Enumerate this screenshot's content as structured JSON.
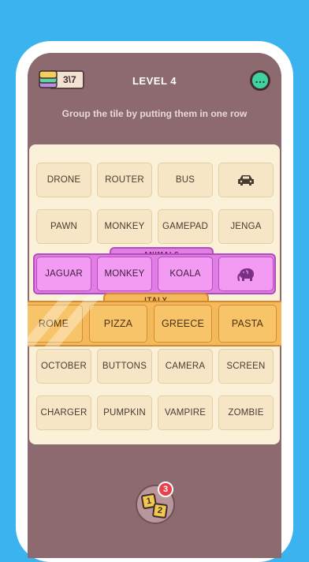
{
  "header": {
    "counter": "3\\7",
    "level_title": "LEVEL 4",
    "menu_icon": "ellipsis-icon"
  },
  "instruction": "Group the tile by putting them in one row",
  "rows": [
    [
      "DRONE",
      "ROUTER",
      "BUS",
      ""
    ],
    [
      "PAWN",
      "MONKEY",
      "GAMEPAD",
      "JENGA"
    ],
    [
      "JAGUAR",
      "MONKEY",
      "KOALA",
      ""
    ],
    [
      "ROME",
      "PIZZA",
      "GREECE",
      "PASTA"
    ],
    [
      "OCTOBER",
      "BUTTONS",
      "CAMERA",
      "SCREEN"
    ],
    [
      "CHARGER",
      "PUMPKIN",
      "VAMPIRE",
      "ZOMBIE"
    ]
  ],
  "groups": {
    "animals": "ANIMALS",
    "italy": "ITALY"
  },
  "icons": {
    "car": "car-icon",
    "elephant": "elephant-icon"
  },
  "hint": {
    "card1": "1",
    "card2": "2",
    "badge": "3"
  },
  "colors": {
    "background": "#3ab3ee",
    "screen": "#8c6a70",
    "board": "#fbf1d9",
    "animals_group": "#e27ee3",
    "italy_group": "#f5b85b",
    "menu_button": "#3fd2a0"
  }
}
